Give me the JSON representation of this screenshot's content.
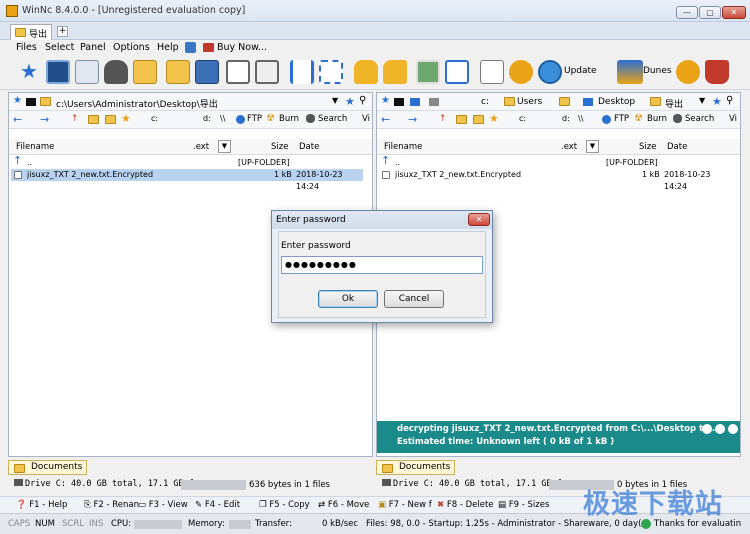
{
  "window": {
    "title": "WinNc 8.4.0.0 - [Unregistered evaluation copy]",
    "minimize": "—",
    "maximize": "▢",
    "close": "✕"
  },
  "tab": {
    "label": "导出",
    "add": "+"
  },
  "menu": [
    "Files",
    "Select",
    "Panel",
    "Options",
    "Help",
    "Buy Now..."
  ],
  "toolbar": {
    "update_label": "Update",
    "dunes_label": "Dunes"
  },
  "left": {
    "path": "c:\\Users\\Administrator\\Desktop\\导出",
    "nav_items": [
      "FTP",
      "Burn",
      "Search",
      "Vi"
    ],
    "drive_items": [
      "c:",
      "d:",
      "\\\\"
    ],
    "headers": {
      "name": "Filename",
      "ext": ".ext",
      "size": "Size",
      "date": "Date"
    },
    "rows": [
      {
        "name": "..",
        "size": "[UP-FOLDER]",
        "date": ""
      },
      {
        "name": "jisuxz_TXT 2_new.txt.Encrypted",
        "size": "1 kB",
        "date": "2018-10-23 14:24"
      }
    ],
    "docs_tab": "Documents",
    "drive_line": "Drive C: 40.0 GB total, 17.1 GB free",
    "bytes_line": "636 bytes in 1 files"
  },
  "right": {
    "path_parts": [
      "c:",
      "Users",
      "Desktop",
      "导出"
    ],
    "nav_items": [
      "FTP",
      "Burn",
      "Search",
      "Vi"
    ],
    "drive_items": [
      "c:",
      "d:",
      "\\\\"
    ],
    "headers": {
      "name": "Filename",
      "ext": ".ext",
      "size": "Size",
      "date": "Date"
    },
    "rows": [
      {
        "name": "..",
        "size": "[UP-FOLDER]",
        "date": ""
      },
      {
        "name": "jisuxz_TXT 2_new.txt.Encrypted",
        "size": "1 kB",
        "date": "2018-10-23 14:24"
      }
    ],
    "docs_tab": "Documents",
    "drive_line": "Drive C: 40.0 GB total, 17.1 GB free",
    "bytes_line": "0 bytes in 1 files"
  },
  "dialog": {
    "title": "Enter password",
    "label": "Enter password",
    "password_mask": "●●●●●●●●●",
    "ok": "Ok",
    "cancel": "Cancel",
    "close": "✕"
  },
  "progress": {
    "line1": "decrypting jisuxz_TXT 2_new.txt.Encrypted from C:\\...\\Desktop to ...",
    "line2": "Estimated time: Unknown left ( 0 kB of 1 kB )"
  },
  "fkeys": [
    "F1 - Help",
    "F2 - Renan",
    "F3 - View",
    "F4 - Edit",
    "F5 - Copy",
    "F6 - Move",
    "F7 - New f",
    "F8 - Delete",
    "F9 - Sizes"
  ],
  "status": {
    "caps": "CAPS",
    "num": "NUM",
    "scrl": "SCRL",
    "ins": "INS",
    "cpu": "CPU:",
    "memory": "Memory:",
    "transfer": "Transfer:",
    "speed": "0 kB/sec",
    "files": "Files: 98, 0.0 - Startup: 1.25s - Administrator - Shareware, 0 day(s)",
    "thanks": "Thanks for evaluatin"
  },
  "watermark": "极速下载站"
}
